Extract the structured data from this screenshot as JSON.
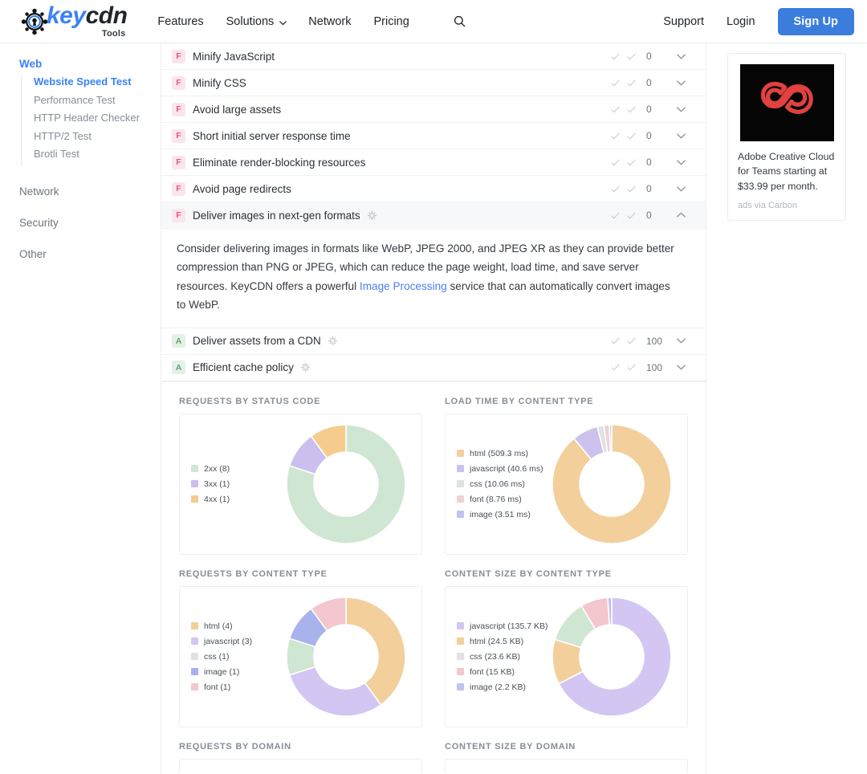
{
  "navbar": {
    "brand": {
      "word_key": "key",
      "word_cdn": "cdn",
      "sub": "Tools",
      "logo_icon": "keycdn-logo-icon"
    },
    "links": [
      {
        "label": "Features",
        "has_caret": false
      },
      {
        "label": "Solutions",
        "has_caret": true
      },
      {
        "label": "Network",
        "has_caret": false
      },
      {
        "label": "Pricing",
        "has_caret": false
      }
    ],
    "search_icon": "search-icon",
    "support_label": "Support",
    "login_label": "Login",
    "signup_label": "Sign Up",
    "accent_color": "#3b7ddd"
  },
  "sidebar": {
    "group_label": "Web",
    "sub_items": [
      {
        "label": "Website Speed Test",
        "active": true
      },
      {
        "label": "Performance Test",
        "active": false
      },
      {
        "label": "HTTP Header Checker",
        "active": false
      },
      {
        "label": "HTTP/2 Test",
        "active": false
      },
      {
        "label": "Brotli Test",
        "active": false
      }
    ],
    "items": [
      {
        "label": "Network"
      },
      {
        "label": "Security"
      },
      {
        "label": "Other"
      }
    ]
  },
  "audits": [
    {
      "grade": "F",
      "title": "Minify JavaScript",
      "score": "0",
      "expanded": false
    },
    {
      "grade": "F",
      "title": "Minify CSS",
      "score": "0",
      "expanded": false
    },
    {
      "grade": "F",
      "title": "Avoid large assets",
      "score": "0",
      "expanded": false
    },
    {
      "grade": "F",
      "title": "Short initial server response time",
      "score": "0",
      "expanded": false
    },
    {
      "grade": "F",
      "title": "Eliminate render-blocking resources",
      "score": "0",
      "expanded": false
    },
    {
      "grade": "F",
      "title": "Avoid page redirects",
      "score": "0",
      "expanded": false
    },
    {
      "grade": "F",
      "title": "Deliver images in next-gen formats",
      "score": "0",
      "expanded": true,
      "has_kcdn_icon": true
    },
    {
      "grade": "A",
      "title": "Deliver assets from a CDN",
      "score": "100",
      "expanded": false,
      "has_kcdn_icon": true
    },
    {
      "grade": "A",
      "title": "Efficient cache policy",
      "score": "100",
      "expanded": false,
      "has_kcdn_icon": true
    }
  ],
  "expanded_detail": {
    "text_part1": "Consider delivering images in formats like WebP, JPEG 2000, and JPEG XR as they can provide better compression than PNG or JPEG, which can reduce the page weight, load time, and save server resources. KeyCDN offers a powerful ",
    "link_label": "Image Processing",
    "text_part2": " service that can automatically convert images to WebP."
  },
  "chart_data": [
    {
      "type": "pie",
      "title": "REQUESTS BY STATUS CODE",
      "categories": [
        "2xx",
        "3xx",
        "4xx"
      ],
      "values": [
        8,
        1,
        1
      ],
      "legend": [
        "2xx (8)",
        "3xx (1)",
        "4xx (1)"
      ],
      "colors": [
        "#cfe6d2",
        "#cbbfee",
        "#f5cc8e"
      ],
      "legend_position": "left",
      "donut": true
    },
    {
      "type": "pie",
      "title": "LOAD TIME BY CONTENT TYPE",
      "categories": [
        "html",
        "javascript",
        "css",
        "font",
        "image"
      ],
      "values": [
        509.3,
        40.6,
        10.06,
        8.76,
        3.51
      ],
      "unit": "ms",
      "legend": [
        "html (509.3 ms)",
        "javascript (40.6 ms)",
        "css (10.06 ms)",
        "font (8.76 ms)",
        "image (3.51 ms)"
      ],
      "colors": [
        "#f3cf9b",
        "#cdc2ee",
        "#dfe2e1",
        "#eed2d6",
        "#bfc3ee"
      ],
      "legend_position": "left",
      "donut": true
    },
    {
      "type": "pie",
      "title": "REQUESTS BY CONTENT TYPE",
      "categories": [
        "html",
        "javascript",
        "css",
        "image",
        "font"
      ],
      "values": [
        4,
        3,
        1,
        1,
        1
      ],
      "legend": [
        "html (4)",
        "javascript (3)",
        "css (1)",
        "image (1)",
        "font (1)"
      ],
      "colors": [
        "#f3cf9b",
        "#d3c6f2",
        "#cfe6d2",
        "#a7b3ea",
        "#f4c6cd"
      ],
      "legend_swatch_colors": [
        "#f3cf9b",
        "#d3c6f2",
        "#dfe2e1",
        "#a7b3ea",
        "#f4c6cd"
      ],
      "legend_position": "left",
      "donut": true
    },
    {
      "type": "pie",
      "title": "CONTENT SIZE BY CONTENT TYPE",
      "categories": [
        "javascript",
        "html",
        "css",
        "font",
        "image"
      ],
      "values": [
        135.7,
        24.5,
        23.6,
        15,
        2.2
      ],
      "unit": "KB",
      "legend": [
        "javascript (135.7 KB)",
        "html (24.5 KB)",
        "css (23.6 KB)",
        "font (15 KB)",
        "image (2.2 KB)"
      ],
      "colors": [
        "#d3c6f2",
        "#f3cf9b",
        "#cfe6d2",
        "#f4c6cd",
        "#bfc3ee"
      ],
      "legend_swatch_colors": [
        "#d3c6f2",
        "#f3cf9b",
        "#dfe2e1",
        "#f4c6cd",
        "#bfc3ee"
      ],
      "legend_position": "left",
      "donut": true
    }
  ],
  "bottom_sections": [
    {
      "title": "REQUESTS BY DOMAIN"
    },
    {
      "title": "CONTENT SIZE BY DOMAIN"
    }
  ],
  "ad": {
    "image_alt": "adobe-creative-cloud-logo",
    "text": "Adobe Creative Cloud for Teams starting at $33.99 per month.",
    "via": "ads via Carbon"
  }
}
